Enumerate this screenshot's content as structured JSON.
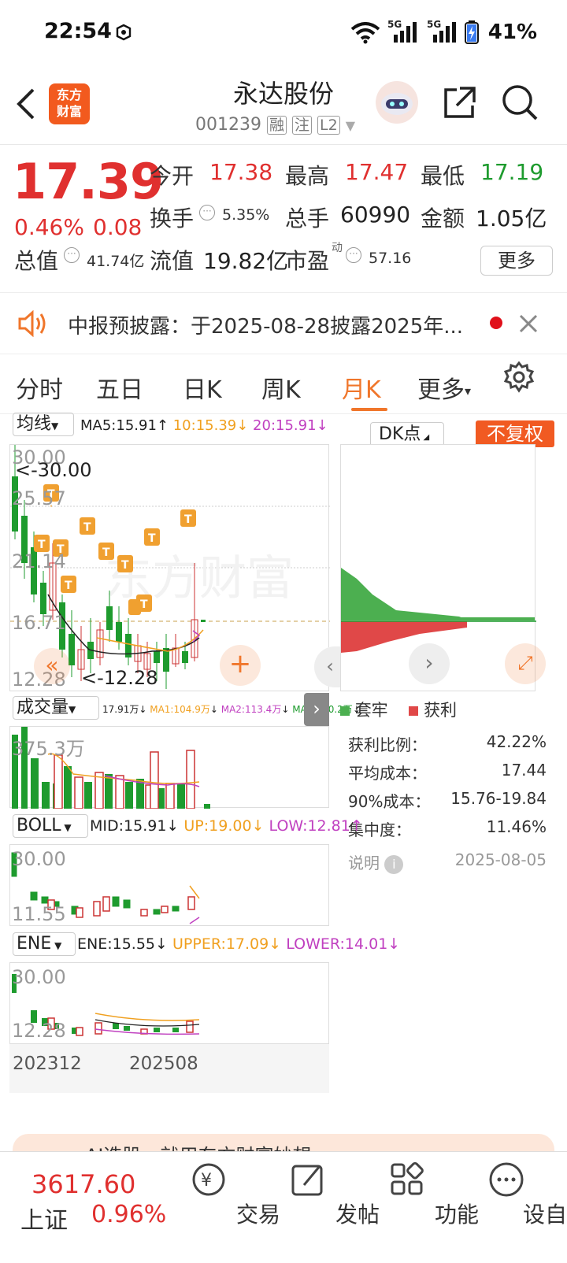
{
  "status_bar": {
    "time": "22:54",
    "battery": "41%",
    "net1": "5G",
    "net2": "5G"
  },
  "header": {
    "app_logo": "东方\n财富",
    "logo_line1": "东方",
    "logo_line2": "财富",
    "stock_name": "永达股份",
    "stock_code": "001239",
    "badges": [
      "融",
      "注",
      "L2"
    ]
  },
  "quote": {
    "price": "17.39",
    "change_pct": "0.46%",
    "change": "0.08",
    "open_label": "今开",
    "open": "17.38",
    "high_label": "最高",
    "high": "17.47",
    "low_label": "最低",
    "low": "17.19",
    "turnover_label": "换手",
    "turnover": "5.35%",
    "volume_label": "总手",
    "volume": "60990",
    "amount_label": "金额",
    "amount": "1.05亿",
    "mktcap_label": "总值",
    "mktcap": "41.74亿",
    "float_label": "流值",
    "float": "19.82亿",
    "pe_label": "市盈",
    "pe_sup": "动",
    "pe": "57.16",
    "more": "更多"
  },
  "notice": {
    "text": "中报预披露：于2025-08-28披露2025年..."
  },
  "tabs": [
    "分时",
    "五日",
    "日K",
    "周K",
    "月K",
    "更多"
  ],
  "tabs_more_arrow": "▾",
  "active_tab": "月K",
  "kline": {
    "ma_selector": "均线",
    "ma5": "MA5:15.91",
    "ma10": "10:15.39",
    "ma20": "20:15.91",
    "arrow_up": "↑",
    "arrow_down": "↓",
    "y_max": "30.00",
    "y_2": "25.57",
    "y_3": "21.14",
    "y_4": "16.71",
    "y_min": "12.28",
    "max_mark": "<-30.00",
    "min_mark": "<-12.28",
    "watermark": "东方财富",
    "t_marker": "T",
    "colors": {
      "up": "#d63a3a",
      "down": "#1e9b2e",
      "ma5": "#222222",
      "ma10": "#f0a020",
      "ma20": "#c040c0"
    }
  },
  "chip": {
    "dk_button": "DK点",
    "fuquan": "不复权",
    "legend_trap": "套牢",
    "legend_profit": "获利",
    "profit_ratio_label": "获利比例：",
    "profit_ratio": "42.22%",
    "avg_cost_label": "平均成本：",
    "avg_cost": "17.44",
    "cost90_label": "90%成本：",
    "cost90": "15.76-19.84",
    "concentration_label": "集中度：",
    "concentration": "11.46%",
    "note_label": "说明",
    "date": "2025-08-05"
  },
  "volume": {
    "selector": "成交量",
    "v": "17.91万",
    "ma1": "MA1:104.9万",
    "ma2": "MA2:113.4万",
    "ma3": "MA3:140.2万",
    "y_max": "375.3万"
  },
  "boll": {
    "selector": "BOLL",
    "mid": "MID:15.91",
    "up": "UP:19.00",
    "low": "LOW:12.81",
    "y_max": "30.00",
    "y_min": "11.55"
  },
  "ene": {
    "selector": "ENE",
    "ene": "ENE:15.55",
    "upper": "UPPER:17.09",
    "lower": "LOWER:14.01",
    "y_max": "30.00",
    "y_min": "12.28"
  },
  "x_axis": [
    "202312",
    "202508"
  ],
  "ai_banner": "AI选股，就用东方财富妙想",
  "bottom_nav": {
    "index_value": "3617.60",
    "index_name": "上证",
    "index_pct": "0.96%",
    "items": [
      "交易",
      "发帖",
      "功能",
      "设自选"
    ]
  }
}
